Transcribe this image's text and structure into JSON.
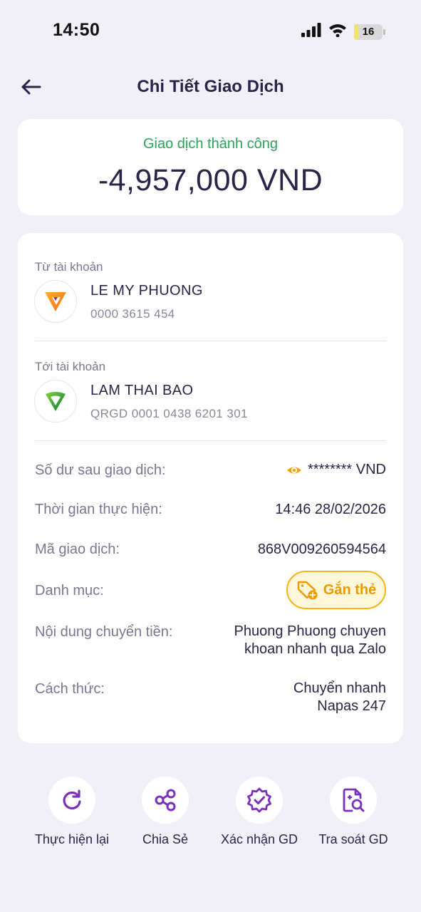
{
  "status_bar": {
    "time": "14:50",
    "battery": "16",
    "battery_level": 0.16
  },
  "header": {
    "title": "Chi Tiết Giao Dịch"
  },
  "summary": {
    "status": "Giao dịch thành công",
    "amount": "-4,957,000 VND"
  },
  "from_account": {
    "label": "Từ tài khoản",
    "name": "LE MY PHUONG",
    "number": "0000 3615 454"
  },
  "to_account": {
    "label": "Tới tài khoản",
    "name": "LAM THAI BAO",
    "number": "QRGD 0001 0438 6201 301"
  },
  "details": {
    "balance_label": "Số dư sau giao dịch:",
    "balance_value": "******** VND",
    "time_label": "Thời gian thực hiện:",
    "time_value": "14:46 28/02/2026",
    "code_label": "Mã giao dịch:",
    "code_value": "868V009260594564",
    "category_label": "Danh mục:",
    "category_button": "Gắn thẻ",
    "content_label": "Nội dung chuyển tiền:",
    "content_line1": "Phuong Phuong chuyen",
    "content_line2": "khoan nhanh qua Zalo",
    "method_label": "Cách thức:",
    "method_line1": "Chuyển nhanh",
    "method_line2": "Napas 247"
  },
  "actions": [
    {
      "label": "Thực hiện lại",
      "icon": "refresh-icon"
    },
    {
      "label": "Chia Sẻ",
      "icon": "share-icon"
    },
    {
      "label": "Xác nhận GD",
      "icon": "verified-badge-icon"
    },
    {
      "label": "Tra soát GD",
      "icon": "document-search-icon"
    }
  ],
  "colors": {
    "accent": "#7b2fbe",
    "success": "#2aa35a",
    "tag": "#f5b315",
    "text": "#2a2447",
    "background": "#f1f0f8"
  }
}
